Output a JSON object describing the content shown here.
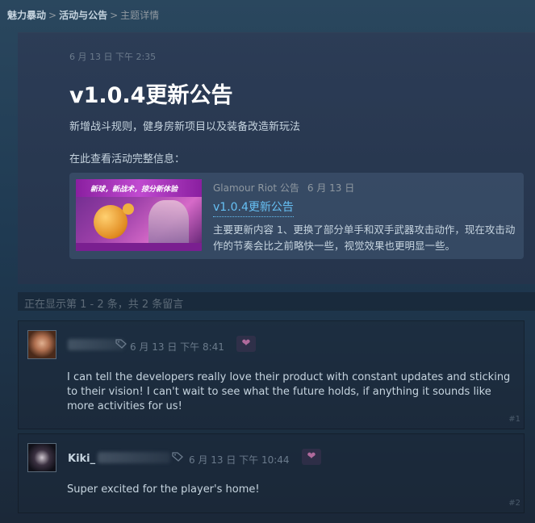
{
  "breadcrumb": {
    "items": [
      "魅力暴动",
      "活动与公告"
    ],
    "current": "主题详情",
    "separator": ">"
  },
  "announcement": {
    "date": "6 月 13 日 下午 2:35",
    "title": "v1.0.4更新公告",
    "subtitle": "新增战斗规则，健身房新项目以及装备改造新玩法",
    "see_more_label": "在此查看活动完整信息：",
    "event": {
      "thumb_banner_text": "新球，新战术，掠分新体验",
      "publisher": "Glamour Riot 公告",
      "date": "6 月 13 日",
      "title": "v1.0.4更新公告",
      "description": "主要更新内容 1、更换了部分单手和双手武器攻击动作，现在攻击动作的节奏会比之前略快一些，视觉效果也更明显一些。"
    }
  },
  "pager": {
    "text": "正在显示第 1 - 2 条，共 2 条留言"
  },
  "comments": [
    {
      "author": "",
      "date": "6 月 13 日 下午 8:41",
      "text": "I can tell the developers really love their product with constant updates and sticking to their vision! I can't wait to see what the future holds, if anything it sounds like more activities for us!",
      "number": "#1"
    },
    {
      "author": "Kiki_",
      "date": "6 月 13 日 下午 10:44",
      "text": "Super excited for the player's home!",
      "number": "#2"
    }
  ],
  "icons": {
    "tag": "tag-icon",
    "award": "award-icon"
  },
  "colors": {
    "link": "#66c0f4",
    "text": "#c6d4df",
    "muted": "#8f98a0",
    "award": "#b06a9c"
  }
}
